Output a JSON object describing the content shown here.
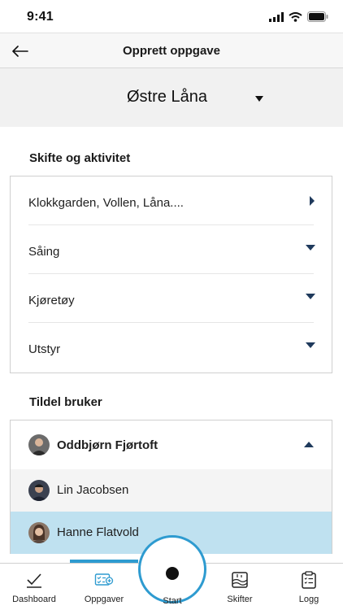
{
  "status_bar": {
    "time": "9:41"
  },
  "header": {
    "title": "Opprett oppgave"
  },
  "location": {
    "name": "Østre Låna"
  },
  "sections": {
    "activity_title": "Skifte og aktivitet",
    "assign_title": "Tildel bruker"
  },
  "activities": [
    {
      "label": "Klokkgarden, Vollen, Låna....",
      "icon": "chevron-right"
    },
    {
      "label": "Såing",
      "icon": "caret-down"
    },
    {
      "label": "Kjøretøy",
      "icon": "caret-down"
    },
    {
      "label": "Utstyr",
      "icon": "caret-down"
    }
  ],
  "assign": {
    "selected": "Oddbjørn Fjørtoft",
    "options": [
      "Lin Jacobsen",
      "Hanne Flatvold"
    ]
  },
  "tabs": {
    "dashboard": "Dashboard",
    "oppgaver": "Oppgaver",
    "start": "Start",
    "skifter": "Skifter",
    "logg": "Logg"
  },
  "colors": {
    "accent": "#2e9bd0",
    "selected_row": "#bfe1f0",
    "caret": "#1f3a5c"
  }
}
